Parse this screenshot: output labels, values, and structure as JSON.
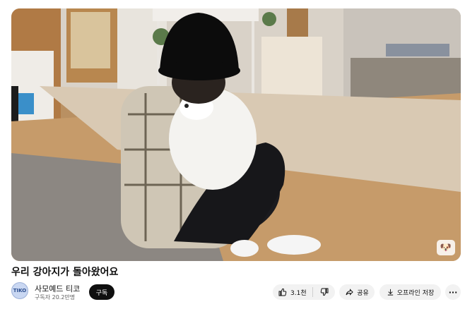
{
  "video": {
    "title": "우리 강아지가 돌아왔어요",
    "thumbnail_description_icon": "video-frame"
  },
  "channel": {
    "name": "사모예드 티코",
    "subscribers": "구독자 20.2만명",
    "avatar_icon": "samoyed-avatar-icon",
    "subscribe_label": "구독"
  },
  "actions": {
    "like_count": "3.1천",
    "share_label": "공유",
    "offline_label": "오프라인 저장",
    "more_icon": "more-horizontal-icon"
  },
  "colors": {
    "subscribe_bg": "#0f0f0f",
    "pill_bg": "#f2f2f2",
    "secondary_text": "#606060"
  }
}
